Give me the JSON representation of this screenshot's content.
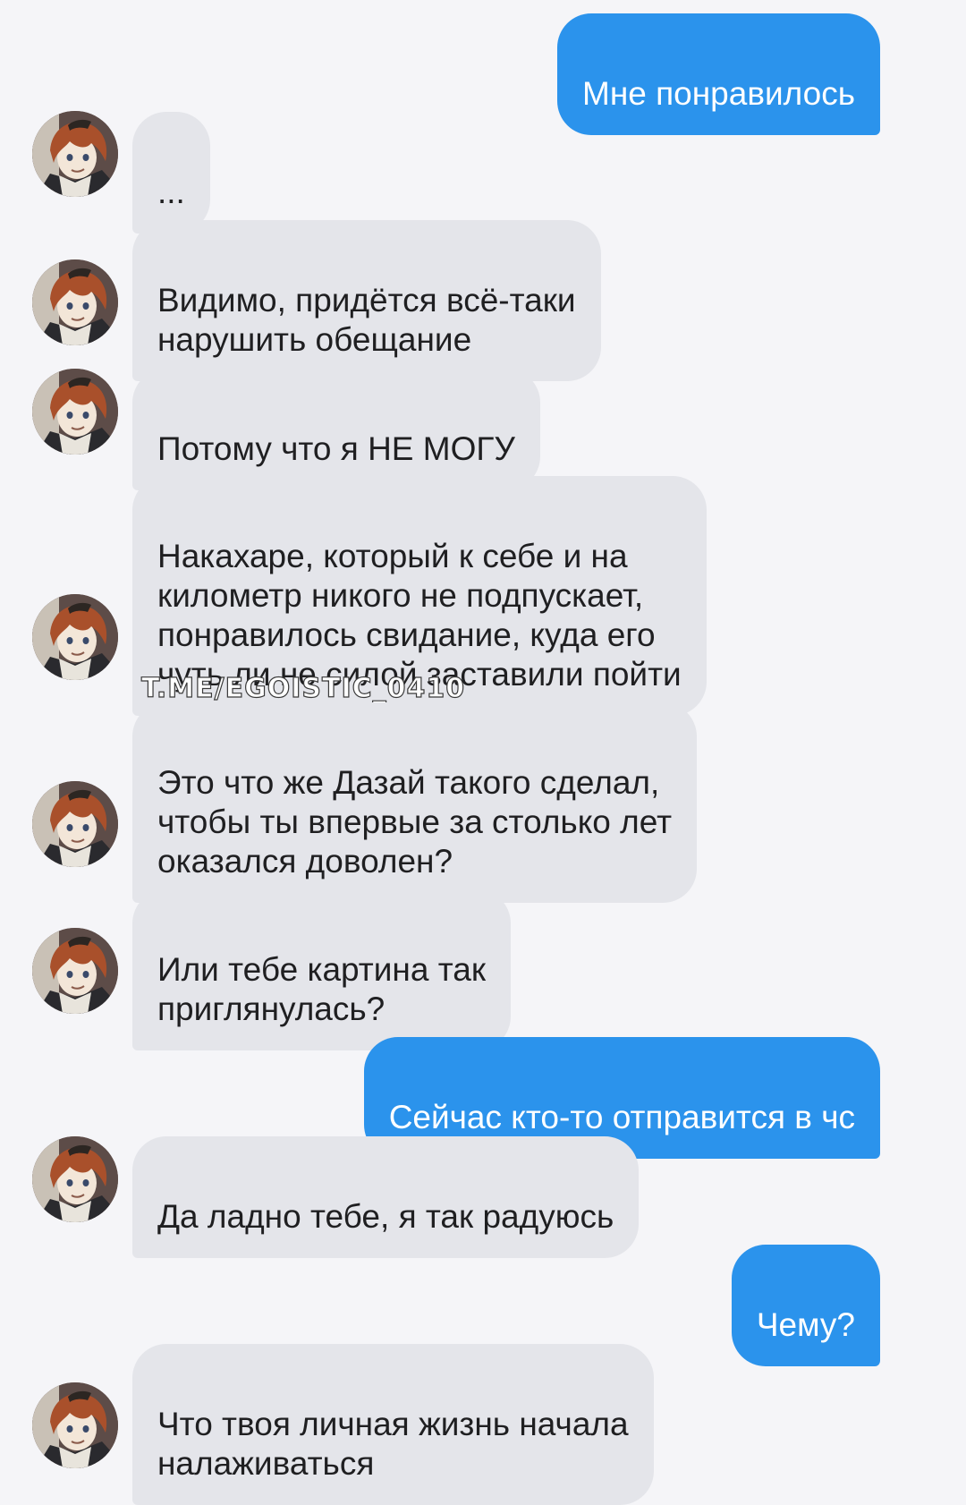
{
  "messages": [
    {
      "dir": "out",
      "text": "Мне понравилось"
    },
    {
      "dir": "in",
      "text": "..."
    },
    {
      "dir": "in",
      "text": "Видимо, придётся всё-таки\nнарушить обещание"
    },
    {
      "dir": "in",
      "text": "Потому что я НЕ МОГУ"
    },
    {
      "dir": "in",
      "text": "Накахаре, который к себе и на\nкилометр никого не подпускает,\nпонравилось свидание, куда его\nчуть ли не силой заставили пойти"
    },
    {
      "dir": "in",
      "text": "Это что же Дазай такого сделал,\nчтобы ты впервые за столько лет\nоказался доволен?"
    },
    {
      "dir": "in",
      "text": "Или тебе картина так\nприглянулась?"
    },
    {
      "dir": "out",
      "text": "Сейчас кто-то отправится в чс"
    },
    {
      "dir": "in",
      "text": "Да ладно тебе, я так радуюсь"
    },
    {
      "dir": "out",
      "text": "Чему?"
    },
    {
      "dir": "in",
      "text": "Что твоя личная жизнь начала\nналаживаться"
    }
  ],
  "watermark": "T.ME/EGOISTIC_0410",
  "colors": {
    "background": "#f5f5f8",
    "outgoing_bubble": "#2b93ec",
    "incoming_bubble": "#e4e5ea"
  },
  "icons": {
    "avatar": "contact-avatar"
  }
}
